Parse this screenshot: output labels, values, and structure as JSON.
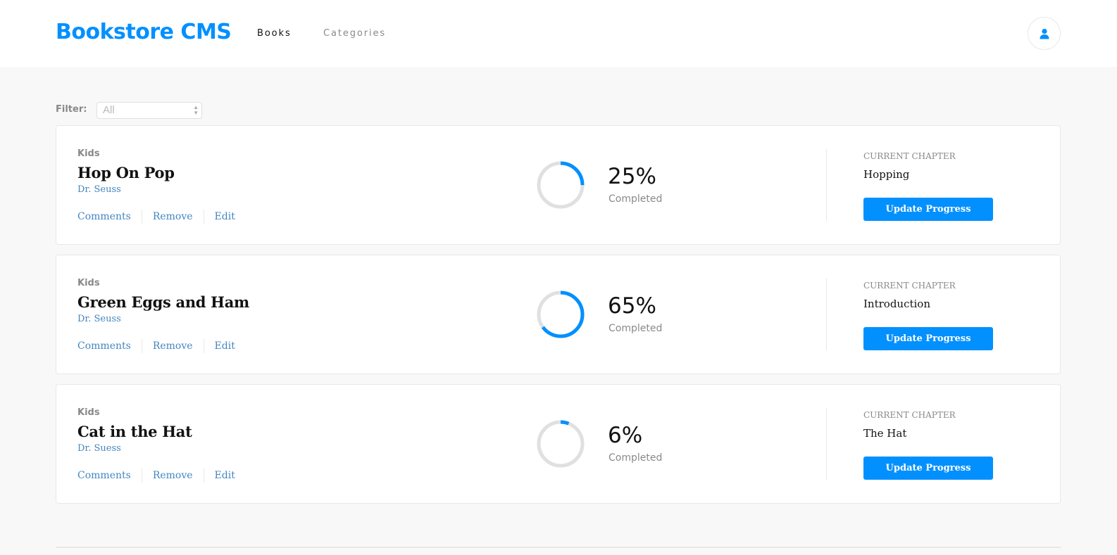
{
  "header": {
    "brand": "Bookstore CMS",
    "nav": [
      {
        "label": "Books",
        "active": true
      },
      {
        "label": "Categories",
        "active": false
      }
    ],
    "user_icon": "user-icon"
  },
  "filter": {
    "label": "Filter:",
    "selected": "All"
  },
  "books": [
    {
      "genre": "Kids",
      "title": "Hop On Pop",
      "author": "Dr. Seuss",
      "percent": 25,
      "percent_label": "25%",
      "completed_label": "Completed",
      "chapter_label": "CURRENT CHAPTER",
      "chapter": "Hopping",
      "button": "Update Progress",
      "actions": [
        "Comments",
        "Remove",
        "Edit"
      ]
    },
    {
      "genre": "Kids",
      "title": "Green Eggs and Ham",
      "author": "Dr. Seuss",
      "percent": 65,
      "percent_label": "65%",
      "completed_label": "Completed",
      "chapter_label": "CURRENT CHAPTER",
      "chapter": "Introduction",
      "button": "Update Progress",
      "actions": [
        "Comments",
        "Remove",
        "Edit"
      ]
    },
    {
      "genre": "Kids",
      "title": "Cat in the Hat",
      "author": "Dr. Suess",
      "percent": 6,
      "percent_label": "6%",
      "completed_label": "Completed",
      "chapter_label": "CURRENT CHAPTER",
      "chapter": "The Hat",
      "button": "Update Progress",
      "actions": [
        "Comments",
        "Remove",
        "Edit"
      ]
    }
  ],
  "colors": {
    "accent": "#0290ff",
    "ring_track": "#e0e0e0",
    "ring_fill": "#0290ff",
    "link": "#4386bf",
    "background": "#f8f8f8"
  }
}
